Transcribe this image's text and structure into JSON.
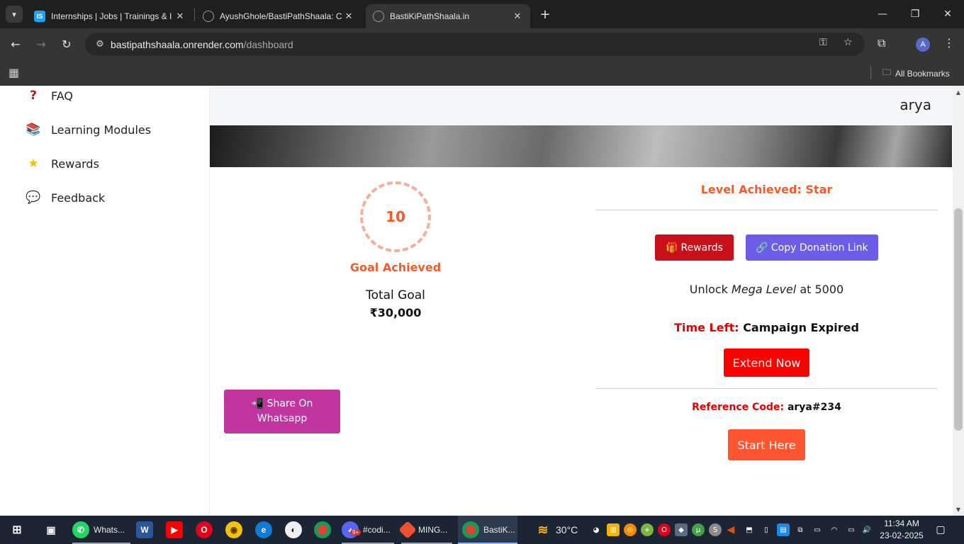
{
  "browser": {
    "tabs": [
      {
        "label": "Internships | Jobs | Trainings & I",
        "favicon": "IS"
      },
      {
        "label": "AyushGhole/BastiPathShaala: C",
        "favicon": "github-icon"
      },
      {
        "label": "BastiKiPathShaala.in",
        "favicon": "globe-icon"
      }
    ],
    "url_host": "bastipathshaala.onrender.com",
    "url_path": "/dashboard",
    "avatar_letter": "A",
    "all_bookmarks": "All Bookmarks"
  },
  "sidebar": {
    "items": [
      {
        "label": "FAQ",
        "icon": "question-icon"
      },
      {
        "label": "Learning Modules",
        "icon": "books-icon"
      },
      {
        "label": "Rewards",
        "icon": "star-icon"
      },
      {
        "label": "Feedback",
        "icon": "chat-icon"
      }
    ]
  },
  "header": {
    "username": "arya"
  },
  "goal": {
    "progress": "10",
    "status": "Goal Achieved",
    "total_label": "Total Goal",
    "total_amount": "₹30,000"
  },
  "share": {
    "label": "📲 Share On Whatsapp"
  },
  "level": {
    "achieved": "Level Achieved: Star",
    "rewards_button": "Rewards",
    "copy_link_button": "Copy Donation Link",
    "unlock_prefix": "Unlock",
    "unlock_level": "Mega Level",
    "unlock_suffix": "at 5000",
    "time_left_label": "Time Left:",
    "time_left_value": "Campaign Expired",
    "extend_button": "Extend Now",
    "ref_label": "Reference Code:",
    "ref_value": "arya#234",
    "start_button": "Start Here"
  },
  "taskbar": {
    "whatsapp": "Whats...",
    "discord": "#codi...",
    "discord_badge": "9+",
    "git": "MING...",
    "chrome": "BastiK...",
    "weather": "30°C",
    "time": "11:34 AM",
    "date": "23-02-2025"
  },
  "colors": {
    "accent_orange": "#f25b2b",
    "rewards_red": "#c8101a",
    "copy_purple": "#6c5ce7",
    "share_magenta": "#c0359f",
    "extend_red": "#ff0000",
    "start_orange": "#ff5530"
  }
}
